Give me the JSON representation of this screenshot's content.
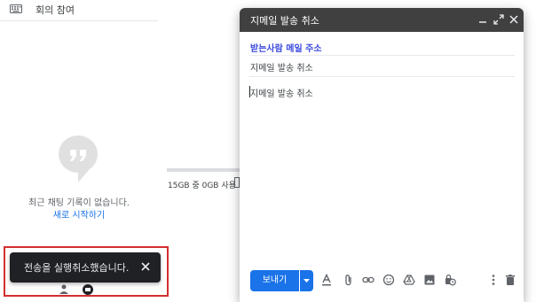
{
  "left_panel": {
    "meet_label": "회의 참여",
    "empty_message": "최근 채팅 기록이 없습니다.",
    "start_link": "새로 시작하기",
    "icons": [
      "keyboard-icon",
      "chat-bubble-icon",
      "person-icon",
      "chat-icon"
    ]
  },
  "toast": {
    "message": "전송을 실행취소했습니다."
  },
  "storage": {
    "text": "15GB 중 0GB 사용"
  },
  "compose": {
    "title": "지메일 발송 취소",
    "recipients": "받는사람 메일 주소",
    "subject": "지메일 발송 취소",
    "body": "지메일 발송 취소",
    "send_label": "보내기",
    "icons": [
      "minimize-icon",
      "fullscreen-icon",
      "close-icon",
      "format-text-icon",
      "attach-icon",
      "link-icon",
      "emoji-icon",
      "drive-icon",
      "photo-icon",
      "confidential-icon",
      "more-options-icon",
      "trash-icon"
    ]
  },
  "colors": {
    "header_bg": "#404040",
    "send_blue": "#1a73e8",
    "recipients_blue": "#3b49df",
    "toast_bg": "#202124",
    "highlight_red": "#d32f2f"
  }
}
